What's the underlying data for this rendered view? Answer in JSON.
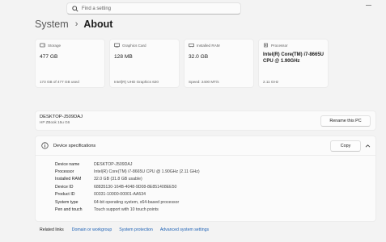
{
  "search": {
    "placeholder": "Find a setting"
  },
  "breadcrumb": {
    "parent": "System",
    "separator": "›",
    "current": "About"
  },
  "cards": [
    {
      "icon": "storage-icon",
      "label": "Storage",
      "value": "477 GB",
      "sub": "173 GB of 477 GB used"
    },
    {
      "icon": "graphics-card-icon",
      "label": "Graphics Card",
      "value": "128 MB",
      "sub": "Intel(R) UHD Graphics 620"
    },
    {
      "icon": "ram-icon",
      "label": "Installed RAM",
      "value": "32.0 GB",
      "sub": "Speed: 2400 MT/s"
    },
    {
      "icon": "processor-icon",
      "label": "Processor",
      "value": "Intel(R) Core(TM) i7-8665U CPU @ 1.90GHz",
      "sub": "2.11 GHz"
    }
  ],
  "device": {
    "name": "DESKTOP-J509DAJ",
    "model": "HP ZBook 15u G6",
    "rename_label": "Rename this PC"
  },
  "specs": {
    "title": "Device specifications",
    "copy_label": "Copy",
    "rows": [
      {
        "key": "Device name",
        "value": "DESKTOP-J509DAJ"
      },
      {
        "key": "Processor",
        "value": "Intel(R) Core(TM) i7-8665U CPU @ 1.90GHz (2.11 GHz)"
      },
      {
        "key": "Installed RAM",
        "value": "32.0 GB (31.8 GB usable)"
      },
      {
        "key": "Device ID",
        "value": "68835130-164B-4048-9D08-8E851408EE50"
      },
      {
        "key": "Product ID",
        "value": "00331-10000-00001-AA534"
      },
      {
        "key": "System type",
        "value": "64-bit operating system, x64-based processor"
      },
      {
        "key": "Pen and touch",
        "value": "Touch support with 10 touch points"
      }
    ]
  },
  "related": {
    "label": "Related links",
    "links": [
      "Domain or workgroup",
      "System protection",
      "Advanced system settings"
    ]
  },
  "colors": {
    "accent": "#1a5fb4",
    "background": "#f3f3f3",
    "card": "#fbfbfb"
  }
}
